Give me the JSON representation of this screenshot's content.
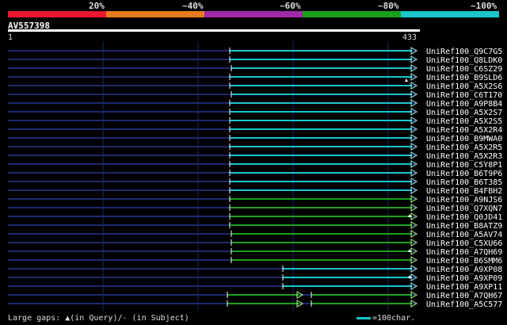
{
  "legend": {
    "colors": [
      "#e8162e",
      "#e87a1e",
      "#a02aa8",
      "#1aa01a",
      "#18c6cc"
    ],
    "labels": [
      "20%",
      "~40%",
      "~60%",
      "~80%",
      "~100%"
    ]
  },
  "query": {
    "name": "AV557398",
    "start": "1",
    "end": "433"
  },
  "footer": {
    "gaps_text": "Large gaps: ▲(in Query)/- (in Subject)",
    "scale_text": "=100char."
  },
  "hits": [
    {
      "name": "UniRef100_Q9C7G5",
      "color": "#18c6cc"
    },
    {
      "name": "UniRef100_Q8LDK0",
      "color": "#18c6cc"
    },
    {
      "name": "UniRef100_C6SZ29",
      "color": "#18c6cc"
    },
    {
      "name": "UniRef100_B9SLD6",
      "color": "#18c6cc"
    },
    {
      "name": "UniRef100_A5X2S6",
      "color": "#18c6cc"
    },
    {
      "name": "UniRef100_C6T170",
      "color": "#18c6cc"
    },
    {
      "name": "UniRef100_A9P8B4",
      "color": "#18c6cc"
    },
    {
      "name": "UniRef100_A5X2S7",
      "color": "#18c6cc"
    },
    {
      "name": "UniRef100_A5X2S5",
      "color": "#18c6cc"
    },
    {
      "name": "UniRef100_A5X2R4",
      "color": "#18c6cc"
    },
    {
      "name": "UniRef100_B9MWA0",
      "color": "#18c6cc"
    },
    {
      "name": "UniRef100_A5X2R5",
      "color": "#18c6cc"
    },
    {
      "name": "UniRef100_A5X2R3",
      "color": "#18c6cc"
    },
    {
      "name": "UniRef100_C5Y8P1",
      "color": "#18c6cc"
    },
    {
      "name": "UniRef100_B6T9P6",
      "color": "#18c6cc"
    },
    {
      "name": "UniRef100_B6T385",
      "color": "#18c6cc"
    },
    {
      "name": "UniRef100_B4FBH2",
      "color": "#18c6cc"
    },
    {
      "name": "UniRef100_A9NJS6",
      "color": "#1aa01a"
    },
    {
      "name": "UniRef100_Q7XQN7",
      "color": "#1aa01a"
    },
    {
      "name": "UniRef100_Q0JD41",
      "color": "#1aa01a"
    },
    {
      "name": "UniRef100_B8ATZ9",
      "color": "#1aa01a"
    },
    {
      "name": "UniRef100_A5AV74",
      "color": "#1aa01a"
    },
    {
      "name": "UniRef100_C5XU66",
      "color": "#1aa01a"
    },
    {
      "name": "UniRef100_A7QH69",
      "color": "#1aa01a"
    },
    {
      "name": "UniRef100_B6SMM6",
      "color": "#1aa01a"
    },
    {
      "name": "UniRef100_A9XP08",
      "color": "#18c6cc"
    },
    {
      "name": "UniRef100_A9XP09",
      "color": "#18c6cc"
    },
    {
      "name": "UniRef100_A9XP11",
      "color": "#18c6cc"
    },
    {
      "name": "UniRef100_A7QH67",
      "color": "#1aa01a"
    },
    {
      "name": "UniRef100_A5C577",
      "color": "#1aa01a"
    }
  ]
}
